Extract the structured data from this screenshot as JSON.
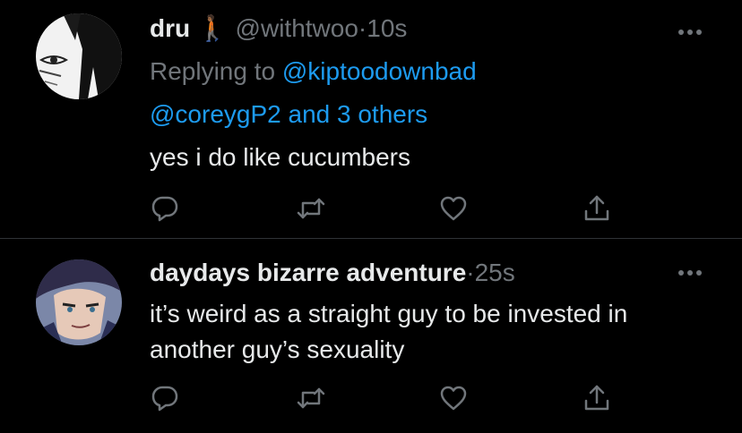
{
  "colors": {
    "background": "#000000",
    "primary_text": "#e7e9ea",
    "secondary_text": "#71767b",
    "link": "#1d9bf0",
    "divider": "#2f3336"
  },
  "tweets": [
    {
      "display_name": "dru",
      "emoji": "🚶🏾",
      "handle": "@withtwoo",
      "separator": "·",
      "time": "10s",
      "replying_prefix": "Replying to",
      "reply_mentions": [
        "@kiptoodownbad",
        "@coreygP2 and 3 others"
      ],
      "text": "yes i do like cucumbers",
      "avatar_icon": "manga-character-avatar",
      "actions": [
        "reply-icon",
        "retweet-icon",
        "like-icon",
        "share-icon"
      ],
      "more_icon": "more-icon"
    },
    {
      "display_name": "daydays bizarre adventure",
      "handle": "",
      "separator": "·",
      "time": "25s",
      "text": "it’s weird as a straight guy to be invested in another guy’s sexuality",
      "avatar_icon": "anime-character-avatar",
      "actions": [
        "reply-icon",
        "retweet-icon",
        "like-icon",
        "share-icon"
      ],
      "more_icon": "more-icon"
    }
  ]
}
